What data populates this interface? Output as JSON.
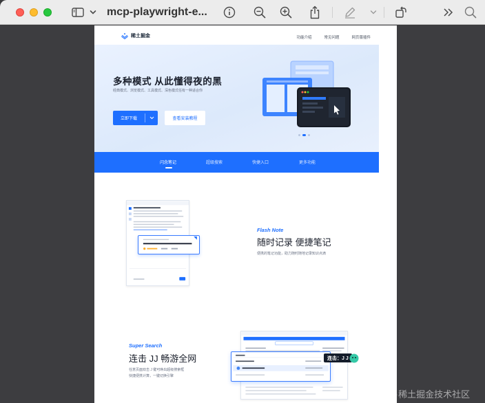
{
  "window": {
    "title": "mcp-playwright-e...",
    "traffic_lights": [
      "close",
      "minimize",
      "zoom"
    ]
  },
  "toolbar": {
    "icons": [
      "sidebar-icon",
      "chevron-down-icon",
      "info-icon",
      "zoom-out-icon",
      "zoom-in-icon",
      "share-icon",
      "markup-pen-icon",
      "chevron-down-icon",
      "rotate-icon",
      "more-chevron-icon",
      "search-icon"
    ]
  },
  "site": {
    "logo_text": "稀土掘金",
    "nav": [
      "功能介绍",
      "常见问题",
      "网页版插件"
    ]
  },
  "hero": {
    "title": "多种模式 从此懂得夜的黑",
    "subtitle": "经典模式、浏览模式、工具模式、深色模式任有一种适合你",
    "download_label": "立即下载",
    "guide_label": "查看安装教程"
  },
  "tabs": [
    {
      "label": "闪念笔记",
      "active": true
    },
    {
      "label": "超级搜索",
      "active": false
    },
    {
      "label": "快捷入口",
      "active": false
    },
    {
      "label": "更多功能",
      "active": false
    }
  ],
  "flash_note": {
    "kicker": "Flash Note",
    "title": "随时记录 便捷笔记",
    "desc": "便携的笔记功能，助力随时随地记录知识点滴"
  },
  "super_search": {
    "kicker": "Super Search",
    "title": "连击 JJ 畅游全网",
    "desc_line1": "任意页面双击 J 键可唤出超级搜索框",
    "desc_line2": "快捷便携计算，一键切换引擎",
    "kbd_badge": "连击：J J"
  },
  "watermark": {
    "at": "@",
    "text": "稀土掘金技术社区"
  },
  "colors": {
    "accent": "#1e6fff",
    "toolbar_bg": "#ececec",
    "canvas_bg": "#3d3d40"
  }
}
